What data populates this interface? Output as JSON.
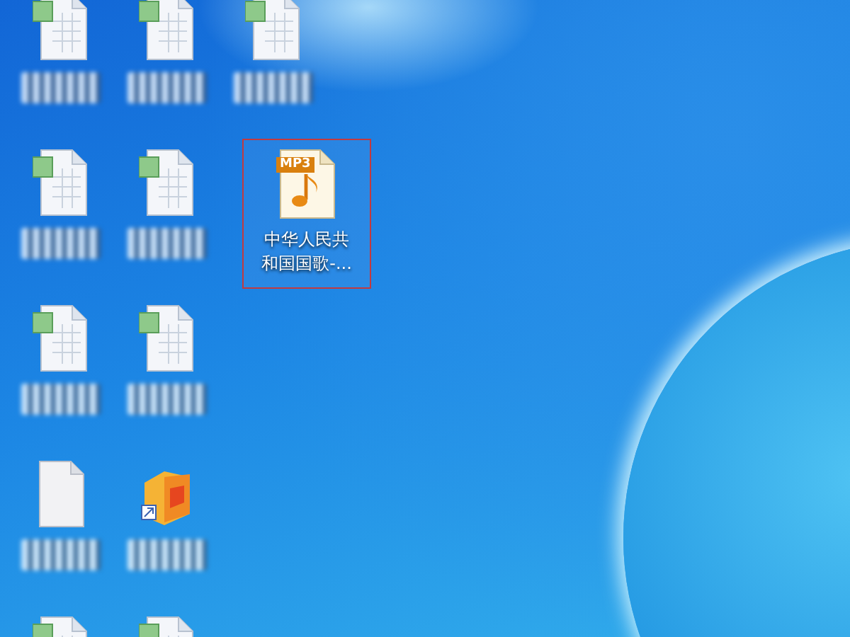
{
  "desktop": {
    "rows": [
      {
        "icons": [
          {
            "kind": "spreadsheet",
            "selected": false
          },
          {
            "kind": "spreadsheet",
            "selected": false
          },
          {
            "kind": "spreadsheet",
            "selected": false
          }
        ]
      },
      {
        "icons": [
          {
            "kind": "spreadsheet",
            "selected": false
          },
          {
            "kind": "spreadsheet",
            "selected": false
          },
          {
            "kind": "mp3",
            "selected": true,
            "badge": "MP3",
            "label": "中华人民共和国国歌-..."
          }
        ]
      },
      {
        "icons": [
          {
            "kind": "spreadsheet",
            "selected": false
          },
          {
            "kind": "spreadsheet",
            "selected": false
          }
        ]
      },
      {
        "icons": [
          {
            "kind": "blank",
            "selected": false
          },
          {
            "kind": "app",
            "selected": false
          }
        ]
      },
      {
        "icons": [
          {
            "kind": "spreadsheet",
            "selected": false
          },
          {
            "kind": "spreadsheet",
            "selected": false
          }
        ]
      }
    ]
  }
}
